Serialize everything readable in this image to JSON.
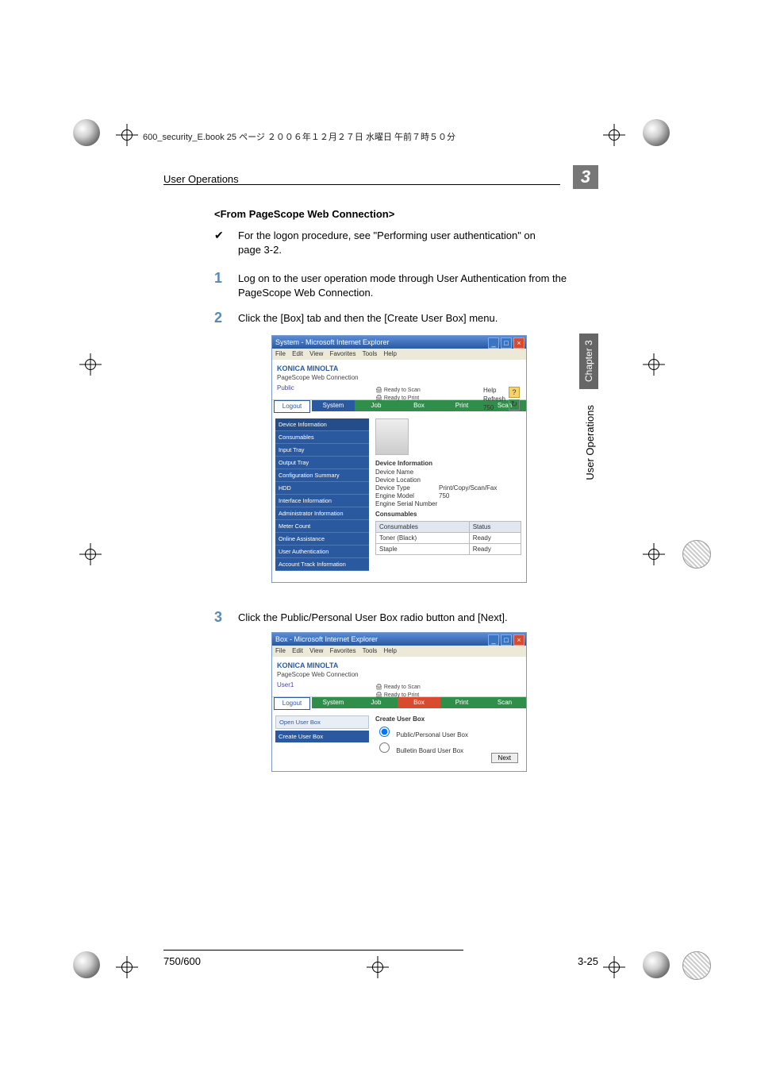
{
  "header_line": "600_security_E.book 25 ページ ２００６年１２月２７日 水曜日 午前７時５０分",
  "running_header": "User Operations",
  "chapter_badge": "3",
  "side_tab": "Chapter 3",
  "side_text": "User Operations",
  "section_title": "<From PageScope Web Connection>",
  "check_text": "For the logon procedure, see \"Performing user authentication\" on page 3-2.",
  "steps": {
    "s1_num": "1",
    "s1_text": "Log on to the user operation mode through User Authentication from the PageScope Web Connection.",
    "s2_num": "2",
    "s2_text": "Click the [Box] tab and then the [Create User Box] menu.",
    "s3_num": "3",
    "s3_text": "Click the Public/Personal User Box radio button and [Next]."
  },
  "ie": {
    "title1": "System - Microsoft Internet Explorer",
    "title2": "Box - Microsoft Internet Explorer",
    "menu": {
      "file": "File",
      "edit": "Edit",
      "view": "View",
      "fav": "Favorites",
      "tools": "Tools",
      "help": "Help"
    }
  },
  "brand": "KONICA MINOLTA",
  "webconn": "PageScope Web Connection",
  "user1": "Public",
  "user2": "User1",
  "status": {
    "scan": "Ready to Scan",
    "print": "Ready to Print"
  },
  "right": {
    "help": "Help",
    "refresh": "Refresh",
    "model": "750"
  },
  "tabs": {
    "logout": "Logout",
    "system": "System",
    "job": "Job",
    "box": "Box",
    "print": "Print",
    "scan": "Scan"
  },
  "nav1": [
    "Device Information",
    "Consumables",
    "Input Tray",
    "Output Tray",
    "Configuration Summary",
    "HDD",
    "Interface Information",
    "Administrator Information",
    "Meter Count",
    "Online Assistance",
    "User Authentication",
    "Account Track Information"
  ],
  "device": {
    "info_h": "Device Information",
    "name": "Device Name",
    "location": "Device Location",
    "type_k": "Device Type",
    "type_v": "Print/Copy/Scan/Fax",
    "model_k": "Engine Model",
    "model_v": "750",
    "serial": "Engine Serial Number"
  },
  "consum": {
    "h": "Consumables",
    "col1": "Consumables",
    "col2": "Status",
    "r1": {
      "k": "Toner (Black)",
      "v": "Ready"
    },
    "r2": {
      "k": "Staple",
      "v": "Ready"
    }
  },
  "nav2": {
    "open": "Open User Box",
    "create": "Create User Box"
  },
  "create": {
    "h": "Create User Box",
    "opt1": "Public/Personal User Box",
    "opt2": "Bulletin Board User Box",
    "next": "Next"
  },
  "footer": {
    "left": "750/600",
    "right": "3-25"
  }
}
